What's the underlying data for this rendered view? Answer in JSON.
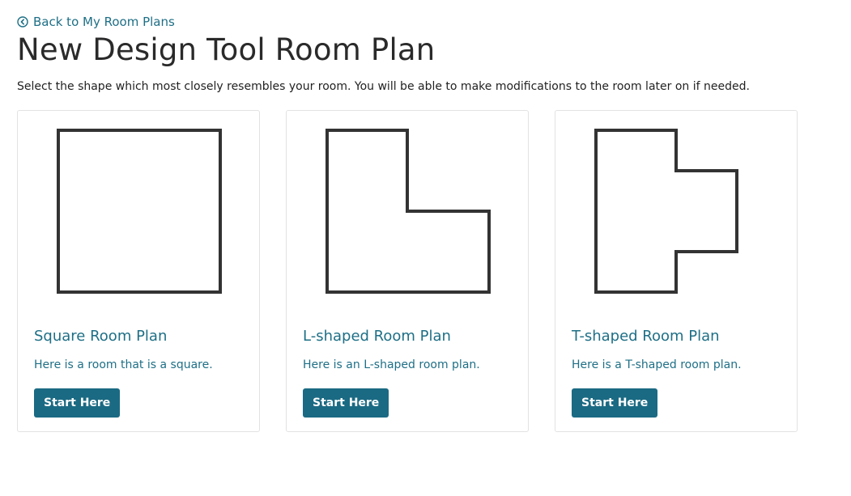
{
  "nav": {
    "back_label": "Back to My Room Plans",
    "back_icon": "circle-chevron-left-icon"
  },
  "header": {
    "title": "New Design Tool Room Plan",
    "subtitle": "Select the shape which most closely resembles your room. You will be able to make modifications to the room later on if needed."
  },
  "colors": {
    "accent": "#1e6f86",
    "button_bg": "#1b6a83",
    "shape_stroke": "#333333",
    "card_border": "#e2e2e2"
  },
  "cards": [
    {
      "shape": "square",
      "title": "Square Room Plan",
      "description": "Here is a room that is a square.",
      "button_label": "Start Here"
    },
    {
      "shape": "l-shape",
      "title": "L-shaped Room Plan",
      "description": "Here is an L-shaped room plan.",
      "button_label": "Start Here"
    },
    {
      "shape": "t-shape",
      "title": "T-shaped Room Plan",
      "description": "Here is a T-shaped room plan.",
      "button_label": "Start Here"
    }
  ]
}
